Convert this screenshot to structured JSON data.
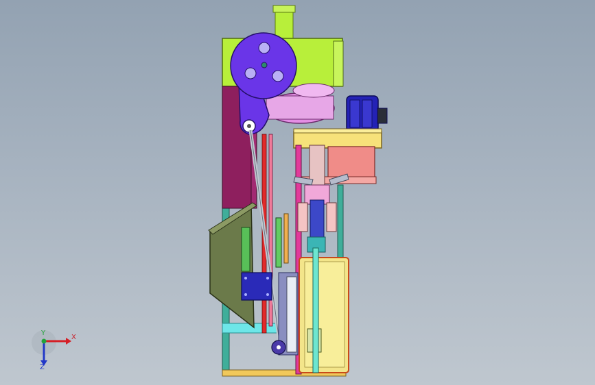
{
  "window": {
    "title": ""
  },
  "viewport": {
    "background_top": "#93a2b2",
    "background_bottom": "#bfc7cf"
  },
  "triad": {
    "x_label": "X",
    "y_label": "Y",
    "z_label": "Z",
    "x_color": "#d51f26",
    "y_color": "#22a33a",
    "z_color": "#2238c8"
  },
  "model": {
    "frame_color": "#b8ef3a",
    "wheel_color": "#6a35e8",
    "motor_color": "#2422b5",
    "hopper_color": "#6b7a4a",
    "cabinet_color": "#f3e58a"
  }
}
